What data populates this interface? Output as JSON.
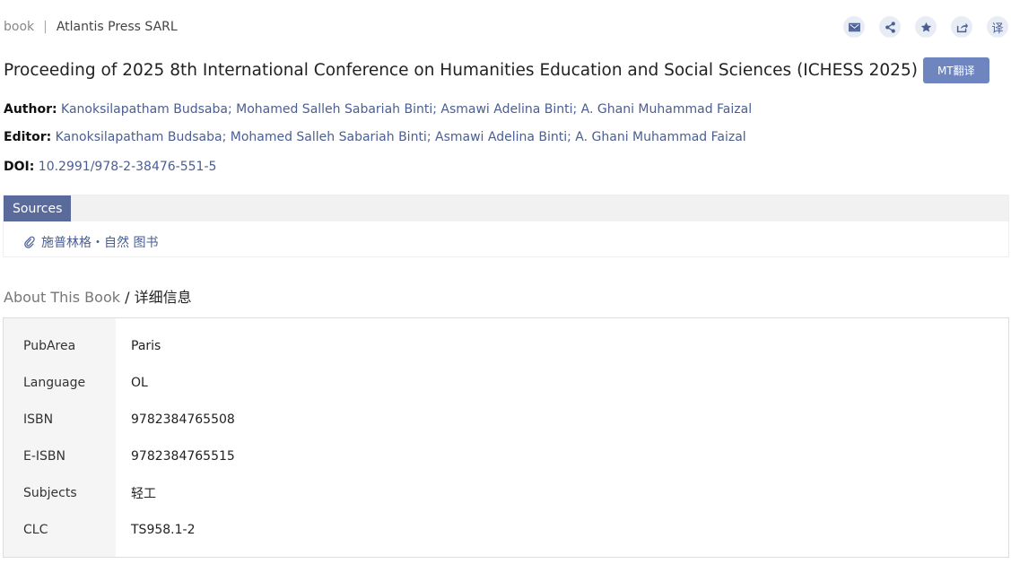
{
  "header": {
    "type": "book",
    "separator": "|",
    "publisher": "Atlantis Press SARL"
  },
  "actions": [
    {
      "icon": "mail-icon"
    },
    {
      "icon": "share-icon"
    },
    {
      "icon": "star-icon"
    },
    {
      "icon": "export-icon"
    },
    {
      "icon": "translate-icon",
      "glyph": "译"
    }
  ],
  "title": "Proceeding of 2025 8th International Conference on Humanities Education and Social Sciences (ICHESS 2025)",
  "mt_button": "MT翻译",
  "author": {
    "label": "Author:",
    "value": "Kanoksilapatham Budsaba; Mohamed Salleh Sabariah Binti; Asmawi Adelina Binti; A. Ghani Muhammad Faizal"
  },
  "editor": {
    "label": "Editor:",
    "value": "Kanoksilapatham Budsaba; Mohamed Salleh Sabariah Binti; Asmawi Adelina Binti; A. Ghani Muhammad Faizal"
  },
  "doi": {
    "label": "DOI:",
    "value": "10.2991/978-2-38476-551-5"
  },
  "sources": {
    "tab": "Sources",
    "link": "施普林格・自然 图书"
  },
  "about": {
    "title": "About This Book",
    "sep": " / ",
    "subtitle": "详细信息"
  },
  "info": [
    {
      "key": "PubArea",
      "value": "Paris"
    },
    {
      "key": "Language",
      "value": "OL"
    },
    {
      "key": "ISBN",
      "value": "9782384765508"
    },
    {
      "key": "E-ISBN",
      "value": "9782384765515"
    },
    {
      "key": "Subjects",
      "value": "轻工"
    },
    {
      "key": "CLC",
      "value": "TS958.1-2"
    }
  ],
  "colors": {
    "accent": "#4a5e93",
    "tab_bg": "#5a6b9b",
    "mt_button": "#6e85c0"
  }
}
